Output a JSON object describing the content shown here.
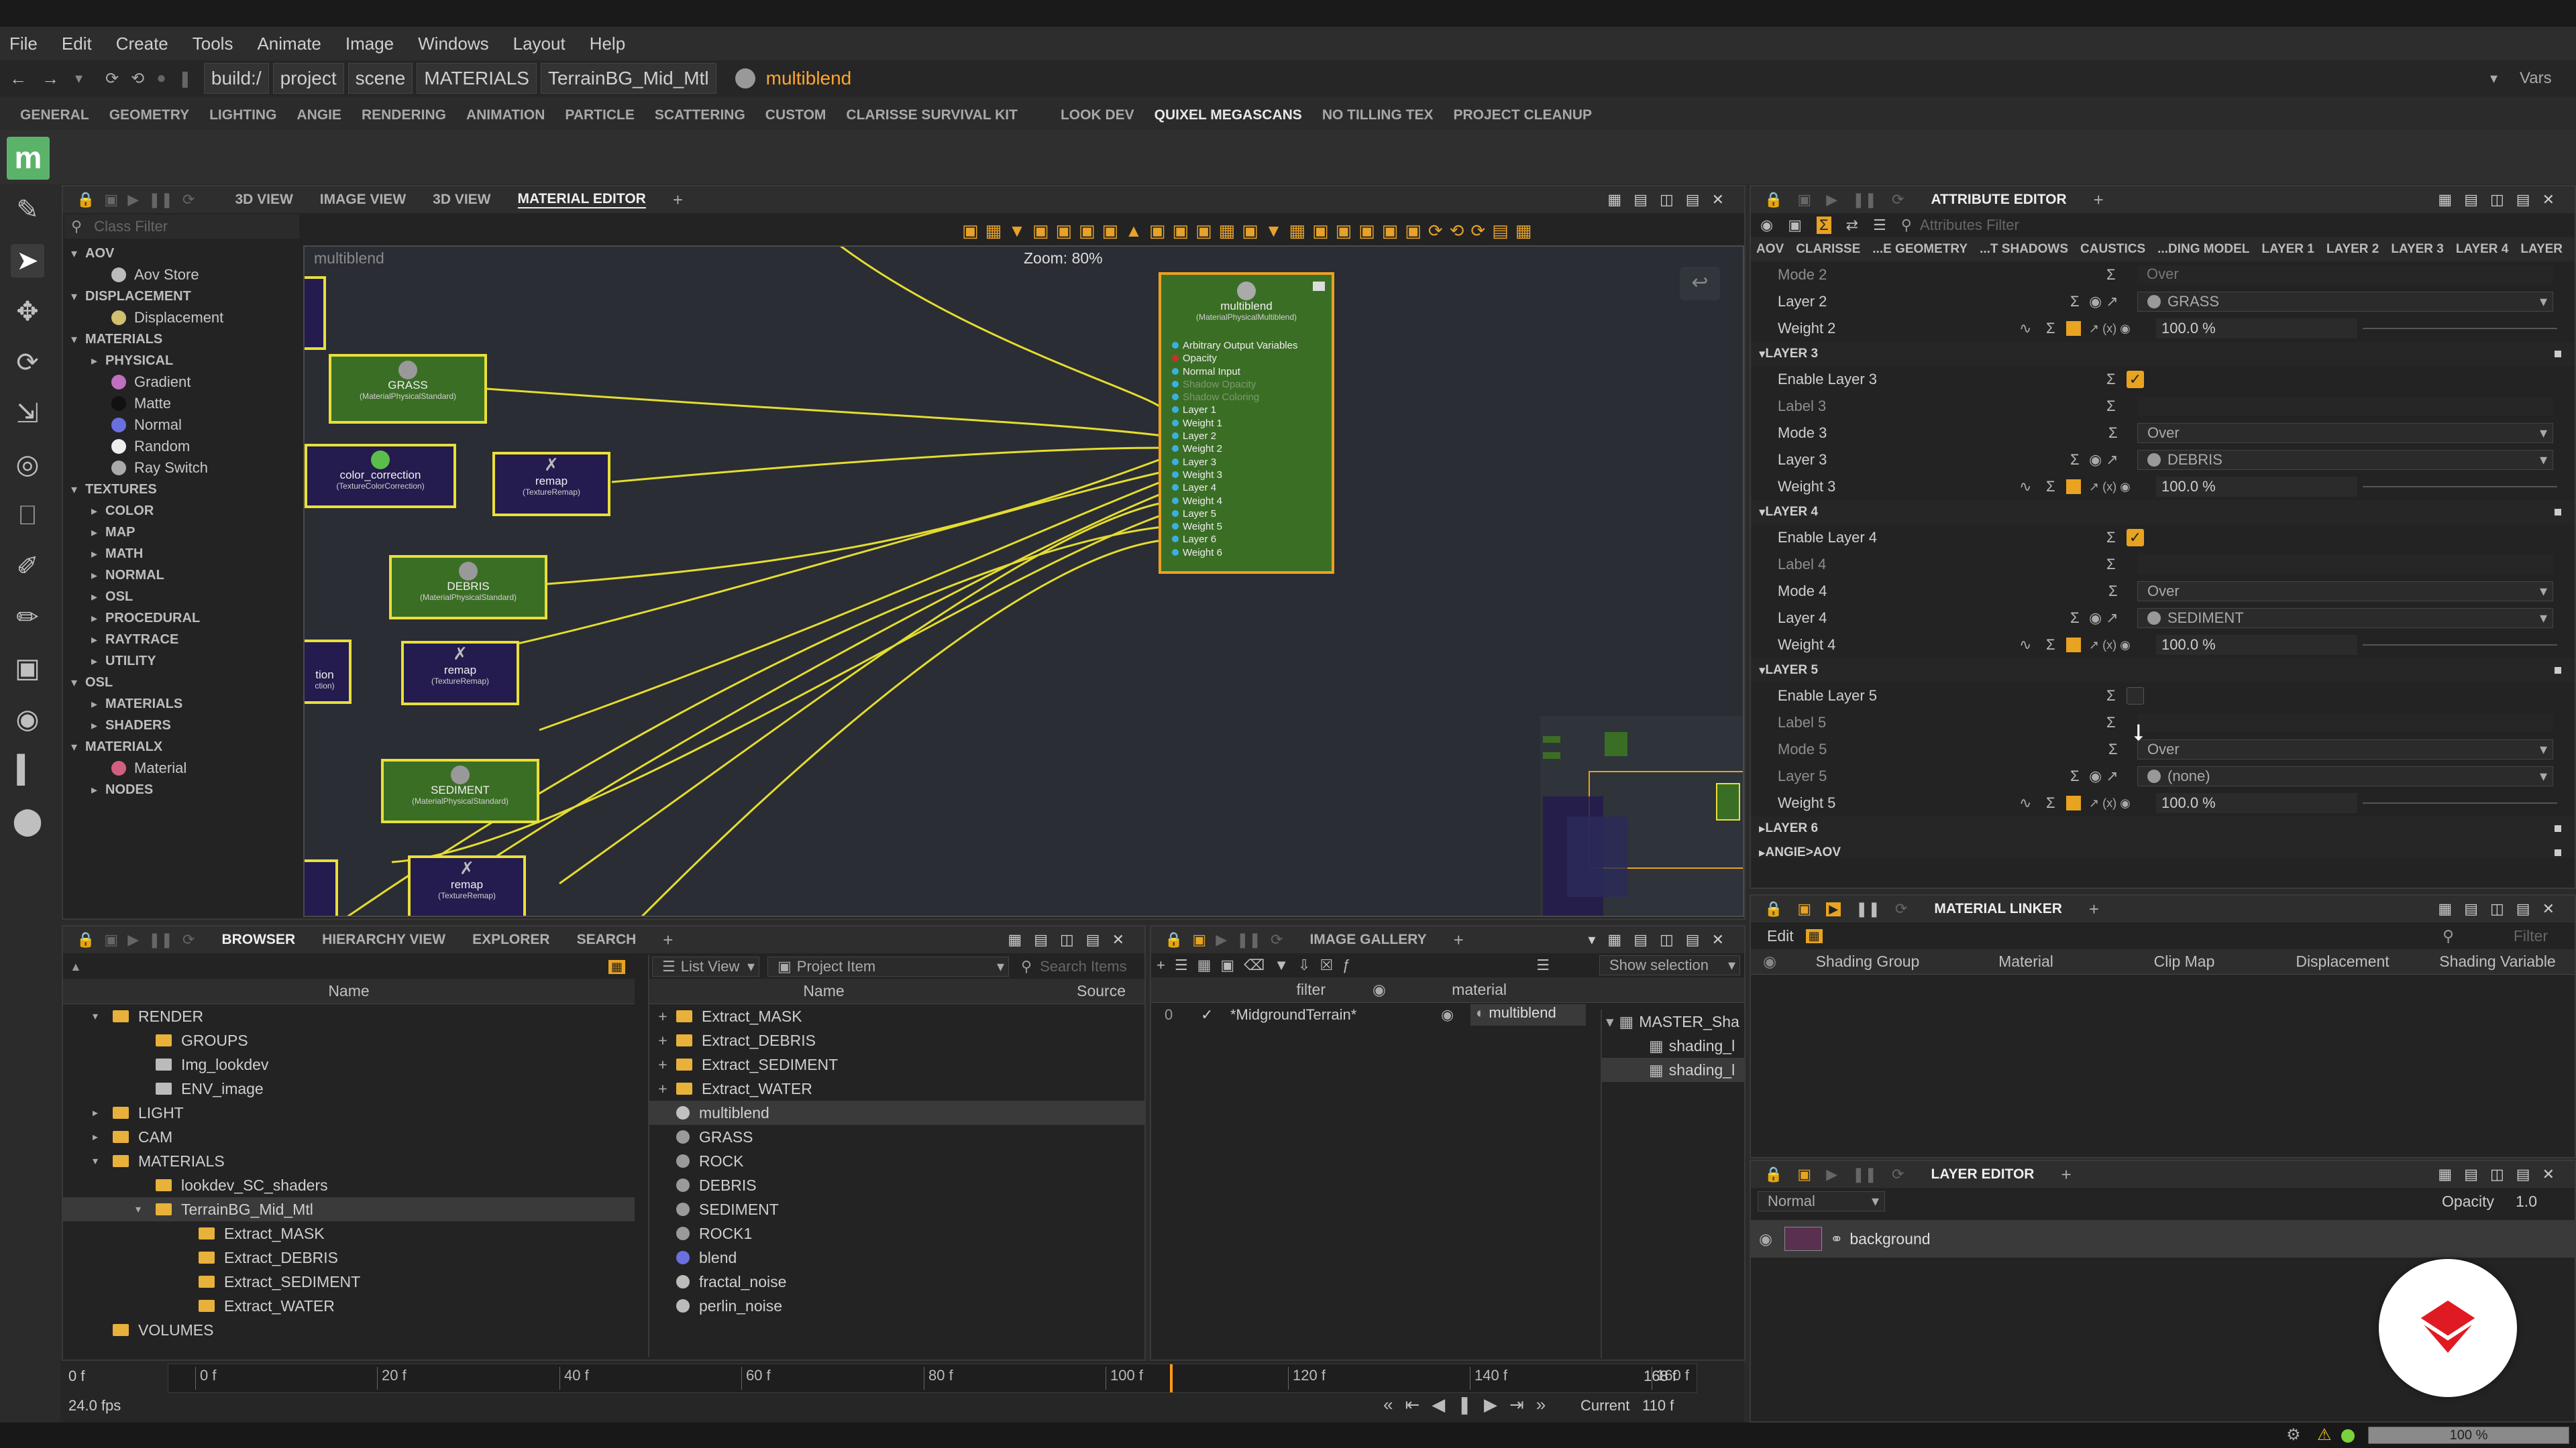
{
  "menu": [
    "File",
    "Edit",
    "Create",
    "Tools",
    "Animate",
    "Image",
    "Windows",
    "Layout",
    "Help"
  ],
  "path": {
    "crumbs": [
      "build:/",
      "project",
      "scene",
      "MATERIALS",
      "TerrainBG_Mid_Mtl"
    ],
    "current": "multiblend",
    "vars": "Vars"
  },
  "shelf_tabs": [
    "GENERAL",
    "GEOMETRY",
    "LIGHTING",
    "ANGIE",
    "RENDERING",
    "ANIMATION",
    "PARTICLE",
    "SCATTERING",
    "CUSTOM",
    "CLARISSE SURVIVAL KIT",
    "LOOK DEV",
    "QUIXEL MEGASCANS",
    "NO TILLING TEX",
    "PROJECT CLEANUP"
  ],
  "view_tabs": [
    "3D VIEW",
    "IMAGE VIEW",
    "3D VIEW",
    "MATERIAL EDITOR"
  ],
  "class_filter_placeholder": "Class Filter",
  "class_tree": [
    {
      "t": "cat",
      "label": "AOV",
      "d": 0
    },
    {
      "t": "item",
      "label": "Aov Store",
      "d": 2,
      "icon": "#bbbbbb"
    },
    {
      "t": "cat",
      "label": "DISPLACEMENT",
      "d": 0
    },
    {
      "t": "item",
      "label": "Displacement",
      "d": 2,
      "icon": "#d0c070"
    },
    {
      "t": "cat",
      "label": "MATERIALS",
      "d": 0
    },
    {
      "t": "cat",
      "label": "PHYSICAL",
      "d": 1
    },
    {
      "t": "item",
      "label": "Gradient",
      "d": 2,
      "icon": "#c070c0"
    },
    {
      "t": "item",
      "label": "Matte",
      "d": 2,
      "icon": "#111111"
    },
    {
      "t": "item",
      "label": "Normal",
      "d": 2,
      "icon": "#6a70e0"
    },
    {
      "t": "item",
      "label": "Random",
      "d": 2,
      "icon": "#eeeeee"
    },
    {
      "t": "item",
      "label": "Ray Switch",
      "d": 2,
      "icon": "#aaaaaa"
    },
    {
      "t": "cat",
      "label": "TEXTURES",
      "d": 0
    },
    {
      "t": "cat",
      "label": "COLOR",
      "d": 1
    },
    {
      "t": "cat",
      "label": "MAP",
      "d": 1
    },
    {
      "t": "cat",
      "label": "MATH",
      "d": 1
    },
    {
      "t": "cat",
      "label": "NORMAL",
      "d": 1
    },
    {
      "t": "cat",
      "label": "OSL",
      "d": 1
    },
    {
      "t": "cat",
      "label": "PROCEDURAL",
      "d": 1
    },
    {
      "t": "cat",
      "label": "RAYTRACE",
      "d": 1
    },
    {
      "t": "cat",
      "label": "UTILITY",
      "d": 1
    },
    {
      "t": "cat",
      "label": "OSL",
      "d": 0
    },
    {
      "t": "cat",
      "label": "MATERIALS",
      "d": 1
    },
    {
      "t": "cat",
      "label": "SHADERS",
      "d": 1
    },
    {
      "t": "cat",
      "label": "MATERIALX",
      "d": 0
    },
    {
      "t": "item",
      "label": "Material",
      "d": 2,
      "icon": "#d06080"
    },
    {
      "t": "cat",
      "label": "NODES",
      "d": 1
    }
  ],
  "graph": {
    "title": "multiblend",
    "zoom": "Zoom: 80%",
    "main_node": {
      "label": "multiblend",
      "sub": "(MaterialPhysicalMultiblend)",
      "ports": [
        "Arbitrary Output Variables",
        "Opacity",
        "Normal Input",
        "Shadow Opacity",
        "Shadow Coloring",
        "Layer 1",
        "Weight 1",
        "Layer 2",
        "Weight 2",
        "Layer 3",
        "Weight 3",
        "Layer 4",
        "Weight 4",
        "Layer 5",
        "Weight 5",
        "Layer 6",
        "Weight 6"
      ]
    },
    "nodes": [
      {
        "label": "GRASS",
        "sub": "(MaterialPhysicalStandard)"
      },
      {
        "label": "color_correction",
        "sub": "(TextureColorCorrection)"
      },
      {
        "label": "remap",
        "sub": "(TextureRemap)"
      },
      {
        "label": "DEBRIS",
        "sub": "(MaterialPhysicalStandard)"
      },
      {
        "label": "tion",
        "sub": "ction)"
      },
      {
        "label": "remap",
        "sub": "(TextureRemap)"
      },
      {
        "label": "SEDIMENT",
        "sub": "(MaterialPhysicalStandard)"
      },
      {
        "label": "remap",
        "sub": "(TextureRemap)"
      }
    ]
  },
  "attr": {
    "tab": "ATTRIBUTE EDITOR",
    "filter_placeholder": "Attributes Filter",
    "subtabs": [
      "AOV",
      "CLARISSE",
      "...E GEOMETRY",
      "...T SHADOWS",
      "CAUSTICS",
      "...DING MODEL",
      "LAYER 1",
      "LAYER 2",
      "LAYER 3",
      "LAYER 4",
      "LAYER"
    ],
    "rows": [
      {
        "k": "row",
        "label": "Mode 2",
        "val": "Over",
        "dim": true
      },
      {
        "k": "row",
        "label": "Layer 2",
        "val": "GRASS",
        "type": "ref"
      },
      {
        "k": "row",
        "label": "Weight 2",
        "val": "100.0 %",
        "type": "num"
      },
      {
        "k": "sec",
        "label": "LAYER 3"
      },
      {
        "k": "row",
        "label": "Enable Layer 3",
        "type": "check",
        "checked": true
      },
      {
        "k": "row",
        "label": "Label 3",
        "dim": true
      },
      {
        "k": "row",
        "label": "Mode 3",
        "val": "Over",
        "type": "drop"
      },
      {
        "k": "row",
        "label": "Layer 3",
        "val": "DEBRIS",
        "type": "ref"
      },
      {
        "k": "row",
        "label": "Weight 3",
        "val": "100.0 %",
        "type": "num"
      },
      {
        "k": "sec",
        "label": "LAYER 4"
      },
      {
        "k": "row",
        "label": "Enable Layer 4",
        "type": "check",
        "checked": true
      },
      {
        "k": "row",
        "label": "Label 4",
        "dim": true
      },
      {
        "k": "row",
        "label": "Mode 4",
        "val": "Over",
        "type": "drop"
      },
      {
        "k": "row",
        "label": "Layer 4",
        "val": "SEDIMENT",
        "type": "ref"
      },
      {
        "k": "row",
        "label": "Weight 4",
        "val": "100.0 %",
        "type": "num"
      },
      {
        "k": "sec",
        "label": "LAYER 5"
      },
      {
        "k": "row",
        "label": "Enable Layer 5",
        "type": "check",
        "checked": false
      },
      {
        "k": "row",
        "label": "Label 5",
        "dim": true
      },
      {
        "k": "row",
        "label": "Mode 5",
        "val": "Over",
        "type": "drop",
        "dim": true
      },
      {
        "k": "row",
        "label": "Layer 5",
        "val": "(none)",
        "type": "ref",
        "dim": true
      },
      {
        "k": "row",
        "label": "Weight 5",
        "val": "100.0 %",
        "type": "num"
      },
      {
        "k": "sec",
        "label": "LAYER 6"
      },
      {
        "k": "sec",
        "label": "ANGIE>AOV"
      }
    ]
  },
  "linker": {
    "tab": "MATERIAL LINKER",
    "edit": "Edit",
    "filter": "Filter",
    "cols": [
      "Shading Group",
      "Material",
      "Clip Map",
      "Displacement",
      "Shading Variable"
    ]
  },
  "layer_editor": {
    "tab": "LAYER EDITOR",
    "blend": "Normal",
    "opacity_label": "Opacity",
    "opacity": "1.0",
    "layer": "background"
  },
  "browser": {
    "tabs": [
      "BROWSER",
      "HIERARCHY VIEW",
      "EXPLORER",
      "SEARCH"
    ],
    "name_col": "Name",
    "tree": [
      {
        "label": "RENDER",
        "d": 1,
        "exp": "open"
      },
      {
        "label": "GROUPS",
        "d": 2
      },
      {
        "label": "Img_lookdev",
        "d": 2,
        "img": true
      },
      {
        "label": "ENV_image",
        "d": 2,
        "img": true
      },
      {
        "label": "LIGHT",
        "d": 1,
        "exp": "closed"
      },
      {
        "label": "CAM",
        "d": 1,
        "exp": "closed"
      },
      {
        "label": "MATERIALS",
        "d": 1,
        "exp": "open"
      },
      {
        "label": "lookdev_SC_shaders",
        "d": 2
      },
      {
        "label": "TerrainBG_Mid_Mtl",
        "d": 2,
        "exp": "open",
        "sel": true
      },
      {
        "label": "Extract_MASK",
        "d": 3
      },
      {
        "label": "Extract_DEBRIS",
        "d": 3
      },
      {
        "label": "Extract_SEDIMENT",
        "d": 3
      },
      {
        "label": "Extract_WATER",
        "d": 3
      },
      {
        "label": "VOLUMES",
        "d": 1
      }
    ],
    "list_view": "List View",
    "project_item": "Project Item",
    "search_placeholder": "Search Items",
    "cols": [
      "Name",
      "Source"
    ],
    "items": [
      {
        "label": "Extract_MASK",
        "kind": "folder"
      },
      {
        "label": "Extract_DEBRIS",
        "kind": "folder"
      },
      {
        "label": "Extract_SEDIMENT",
        "kind": "folder"
      },
      {
        "label": "Extract_WATER",
        "kind": "folder"
      },
      {
        "label": "multiblend",
        "kind": "mb",
        "sel": true
      },
      {
        "label": "GRASS",
        "kind": "mat"
      },
      {
        "label": "ROCK",
        "kind": "mat"
      },
      {
        "label": "DEBRIS",
        "kind": "mat"
      },
      {
        "label": "SEDIMENT",
        "kind": "mat"
      },
      {
        "label": "ROCK1",
        "kind": "mat"
      },
      {
        "label": "blend",
        "kind": "blend"
      },
      {
        "label": "fractal_noise",
        "kind": "noise"
      },
      {
        "label": "perlin_noise",
        "kind": "noise"
      }
    ]
  },
  "gallery": {
    "tab": "IMAGE GALLERY",
    "show_selection": "Show selection",
    "cols": [
      "filter",
      "material"
    ],
    "row_index": "0",
    "filter_val": "*MidgroundTerrain*",
    "material_val": "multiblend",
    "right_items": [
      "MASTER_Sha",
      "shading_l",
      "shading_l"
    ]
  },
  "timeline": {
    "start": "0 f",
    "ticks": [
      "0 f",
      "20 f",
      "40 f",
      "60 f",
      "80 f",
      "100 f",
      "120 f",
      "140 f",
      "160 f"
    ],
    "end": "168 f",
    "fps": "24.0 fps",
    "current_label": "Current",
    "current": "110 f",
    "current_frac": 0.655
  },
  "status": {
    "zoom": "100 %"
  }
}
